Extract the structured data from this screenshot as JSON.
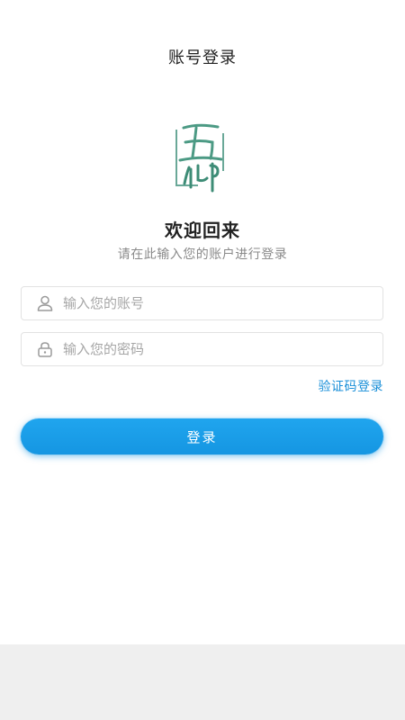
{
  "header": {
    "title": "账号登录"
  },
  "logo": {
    "text_top": "五",
    "text_bottom": "仰"
  },
  "welcome": {
    "title": "欢迎回来",
    "subtitle": "请在此输入您的账户进行登录"
  },
  "form": {
    "account": {
      "placeholder": "输入您的账号",
      "value": "",
      "icon": "user-icon"
    },
    "password": {
      "placeholder": "输入您的密码",
      "value": "",
      "icon": "lock-icon"
    }
  },
  "links": {
    "code_login": "验证码登录"
  },
  "buttons": {
    "login": "登录"
  },
  "colors": {
    "accent": "#1a8fd8",
    "button": "#1596e2",
    "logo_green": "#4c9a84",
    "footer_bg": "#efefef"
  }
}
